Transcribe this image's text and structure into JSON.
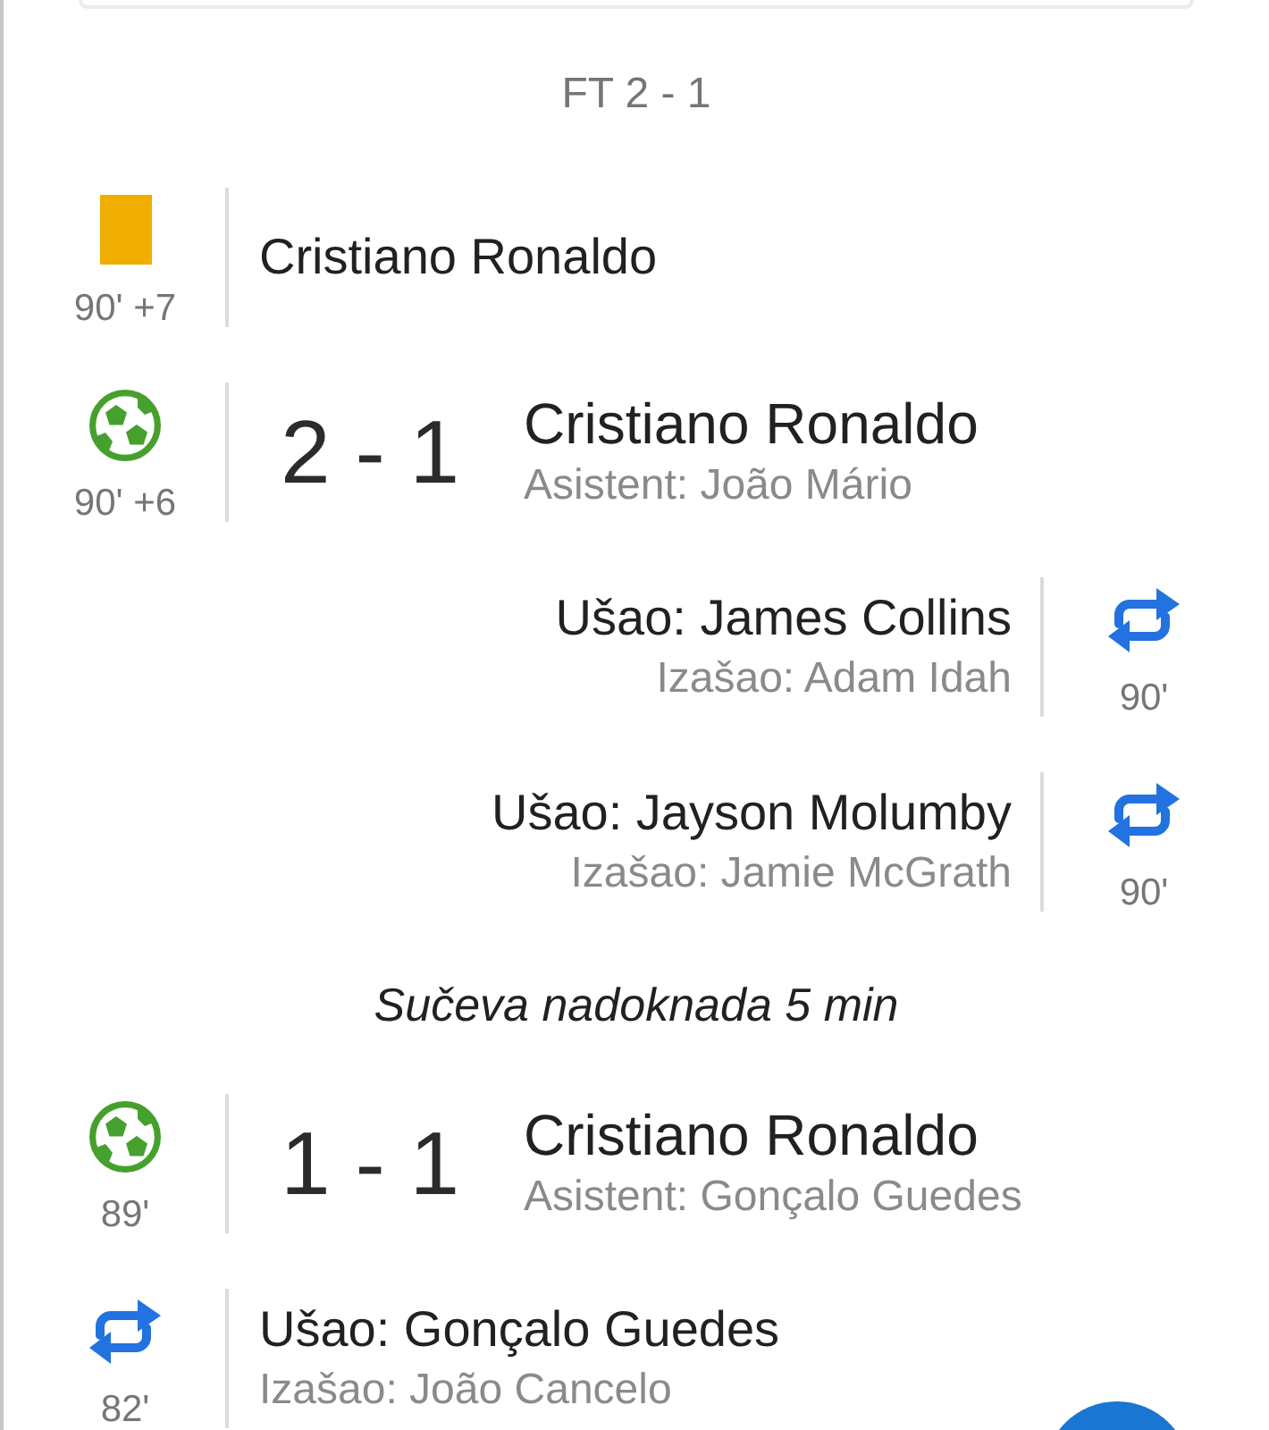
{
  "header": {
    "status": "FT 2 - 1"
  },
  "events": [
    {
      "kind": "booking",
      "away": false,
      "time": "90' +7",
      "player": "Cristiano Ronaldo"
    },
    {
      "kind": "goal",
      "away": false,
      "time": "90' +6",
      "score": "2 - 1",
      "player": "Cristiano Ronaldo",
      "assist": "Asistent: João Mário"
    },
    {
      "kind": "substitution",
      "away": true,
      "time": "90'",
      "player_in": "Ušao: James Collins",
      "player_out": "Izašao: Adam Idah"
    },
    {
      "kind": "substitution",
      "away": true,
      "time": "90'",
      "player_in": "Ušao: Jayson Molumby",
      "player_out": "Izašao: Jamie McGrath"
    },
    {
      "kind": "note",
      "text": "Sučeva nadoknada 5 min"
    },
    {
      "kind": "goal",
      "away": false,
      "time": "89'",
      "score": "1 - 1",
      "player": "Cristiano Ronaldo",
      "assist": "Asistent: Gonçalo Guedes"
    },
    {
      "kind": "substitution",
      "away": false,
      "time": "82'",
      "player_in": "Ušao: Gonçalo Guedes",
      "player_out": "Izašao: João Cancelo"
    }
  ]
}
